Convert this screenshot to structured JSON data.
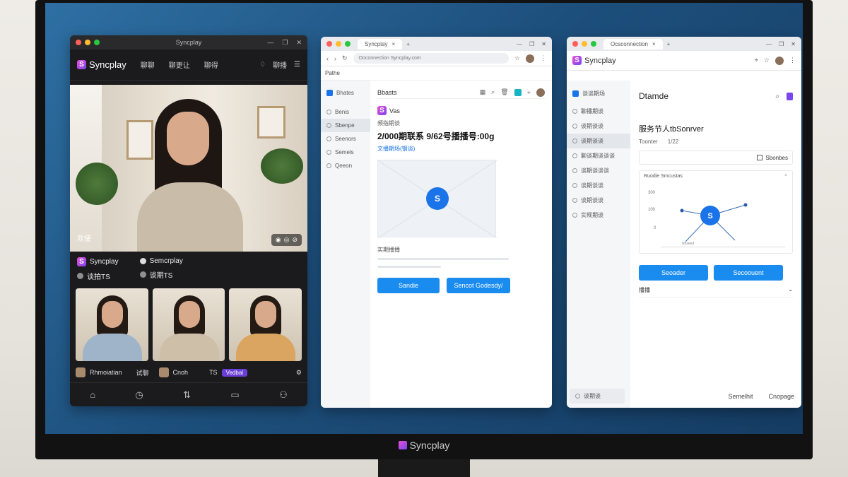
{
  "monitor": {
    "brand": "Syncplay"
  },
  "w1": {
    "titlebar": "Syncplay",
    "brand": "Syncplay",
    "nav": [
      "聊聊",
      "聊更让",
      "聊得"
    ],
    "header_action": "聊播",
    "video_label": "欢使",
    "participants_left": {
      "name": "Syncplay",
      "sub": "谈拍TS"
    },
    "participants_right": {
      "name": "Semcrplay",
      "sub": "谈期TS"
    },
    "thumb_labels": [
      {
        "name": "Rhmoiatian",
        "tag": "试聊"
      },
      {
        "name": "Cnoh",
        "tag": "TS",
        "pill": "Vedbal"
      }
    ],
    "bottom_nav": [
      "home-icon",
      "clock-icon",
      "sync-icon",
      "chat-icon",
      "profile-icon"
    ]
  },
  "w2": {
    "tab": "Syncplay",
    "url": "Ooconnection Syncplay.com",
    "bookmark": "Pathe",
    "sidebar": [
      {
        "label": "Bhates",
        "active": false,
        "icon": "square"
      },
      {
        "label": "Benis",
        "active": false
      },
      {
        "label": "Sbenpe",
        "active": true
      },
      {
        "label": "Seenors",
        "active": false
      },
      {
        "label": "Semels",
        "active": false
      },
      {
        "label": "Qeeon",
        "active": false
      }
    ],
    "subbar_title": "Bbasts",
    "app_name": "Vas",
    "caption": "频指期谈",
    "heading": "2/000期联系 9/62号播播号:00g",
    "link": "文播期场(钢谈)",
    "section_label": "实期播播",
    "btn_primary": "Sandie",
    "btn_secondary": "Sencot Godesdy/"
  },
  "w3": {
    "tab": "Ocsconnection",
    "brand": "Syncplay",
    "sidebar": [
      {
        "label": "谈谈期场",
        "active": false,
        "icon": "square"
      },
      {
        "label": "聊播期谈",
        "active": false
      },
      {
        "label": "谈期谈谈",
        "active": false
      },
      {
        "label": "谈期谈谈",
        "active": true
      },
      {
        "label": "聊谈期谈谈谈",
        "active": false
      },
      {
        "label": "谈期谈谈谈",
        "active": false
      },
      {
        "label": "谈期谈谈",
        "active": false
      },
      {
        "label": "谈期谈谈",
        "active": false
      },
      {
        "label": "实规期谈",
        "active": false
      }
    ],
    "title": "Dtamde",
    "heading": "服务节人tbSonrver",
    "meta_left": "Toonter",
    "meta_right": "1/22",
    "box_label": "Sbonbes",
    "chart_caption": "Ruodie Smcustas",
    "y_ticks": [
      "300",
      "100",
      "0"
    ],
    "x_caption": "Nnseed",
    "btn_primary": "Seoader",
    "btn_secondary": "Secoouent",
    "row_label": "播播",
    "sidebar_footer": "谈期谈",
    "foot_left": "Semelhit",
    "foot_right": "Cnopage"
  }
}
